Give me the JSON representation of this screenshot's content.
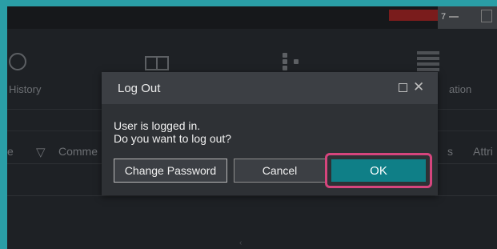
{
  "background": {
    "top_counter": "7",
    "history_label": "History",
    "right_label": "ation",
    "columns": {
      "col1": "e",
      "col2": "Comme",
      "col3": "s",
      "col4": "Attri"
    }
  },
  "dialog": {
    "title": "Log Out",
    "message_line1": "User is logged in.",
    "message_line2": "Do you want to log out?",
    "buttons": {
      "change_password": "Change Password",
      "cancel": "Cancel",
      "ok": "OK"
    }
  },
  "colors": {
    "accent_teal": "#0f7f87",
    "highlight_pink": "#d6457d",
    "frame_border": "#2a9ea6"
  }
}
